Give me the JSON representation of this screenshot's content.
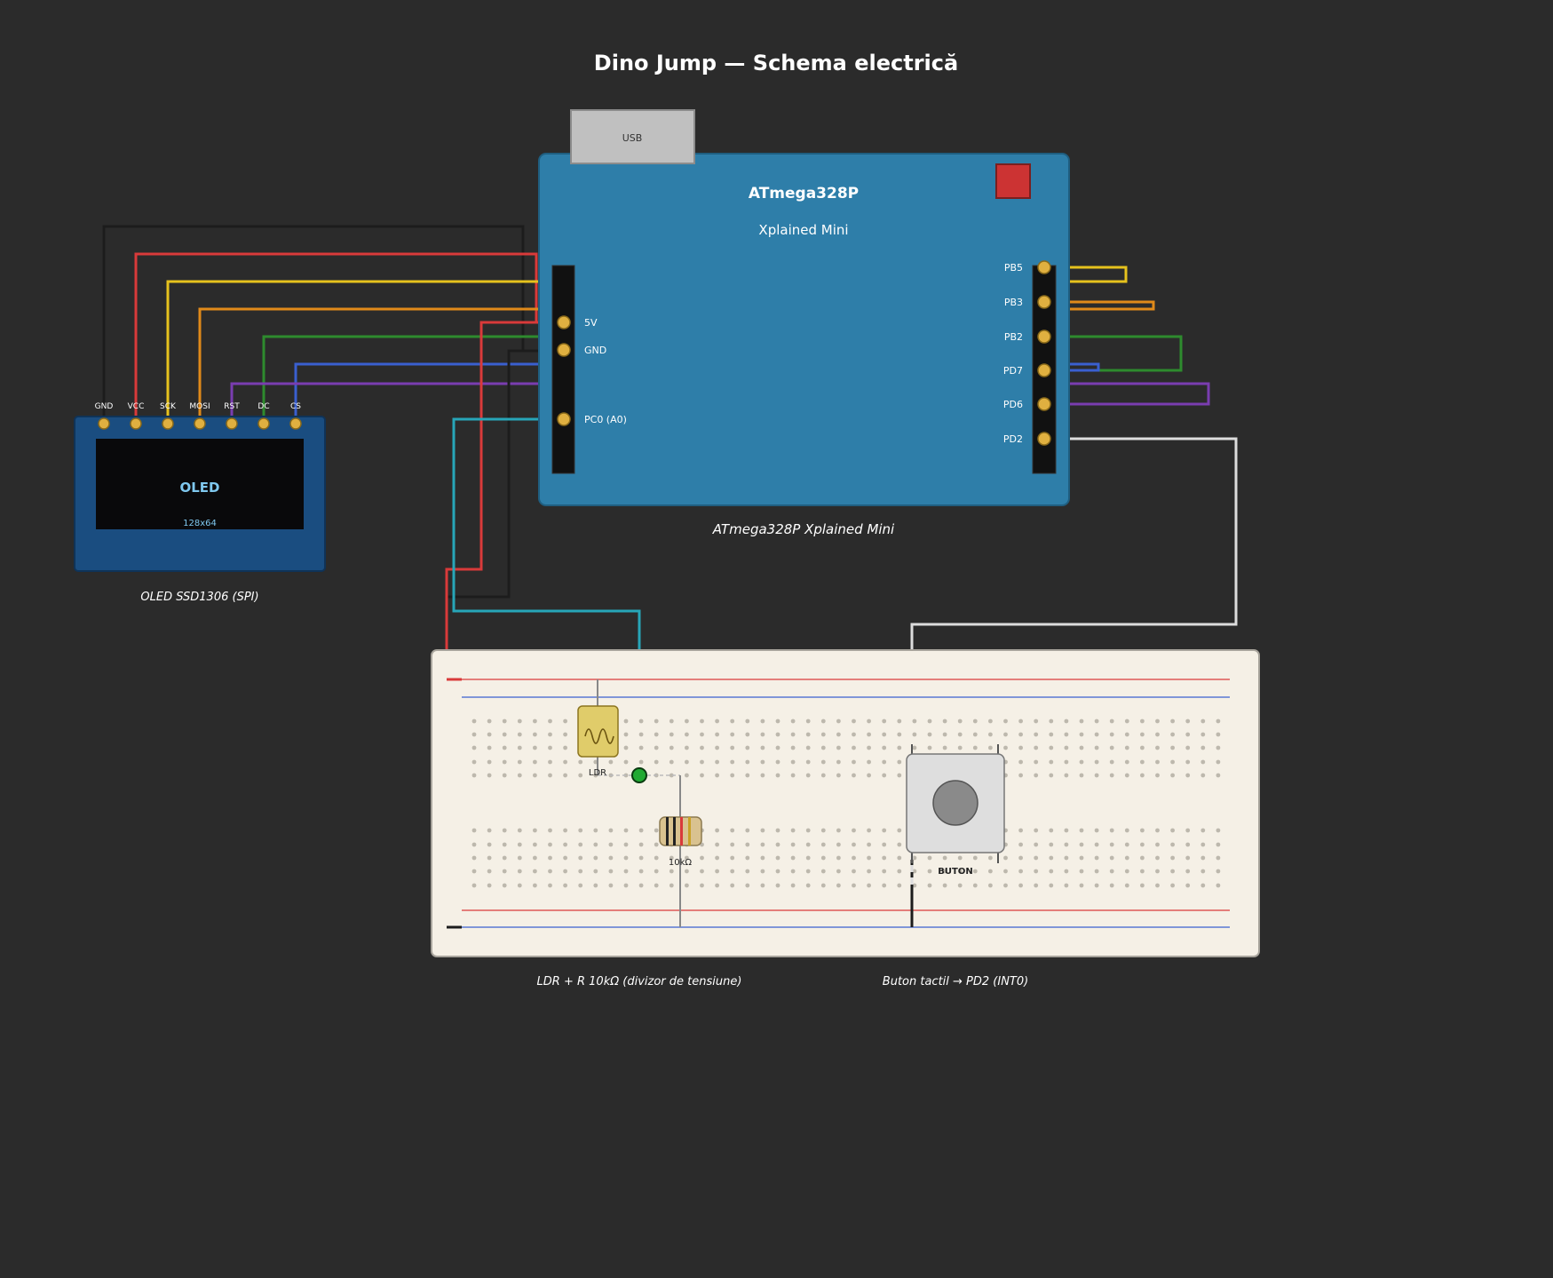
{
  "title": "Dino Jump — Schema electrică",
  "board": {
    "usb_label": "USB",
    "name": "ATmega328P",
    "subtitle": "Xplained Mini",
    "caption": "ATmega328P Xplained Mini",
    "left_pins": [
      "5V",
      "GND",
      "PC0 (A0)"
    ],
    "right_pins": [
      "PB5",
      "PB3",
      "PB2",
      "PD7",
      "PD6",
      "PD2"
    ]
  },
  "oled": {
    "pins": [
      "GND",
      "VCC",
      "SCK",
      "MOSI",
      "RST",
      "DC",
      "CS"
    ],
    "screen_label": "OLED",
    "resolution": "128x64",
    "caption": "OLED SSD1306 (SPI)"
  },
  "breadboard": {
    "ldr_label": "LDR",
    "resistor_label": "10kΩ",
    "button_label": "BUTON",
    "caption_divider": "LDR + R 10kΩ (divizor de tensiune)",
    "caption_button": "Buton tactil → PD2 (INT0)"
  },
  "colors": {
    "background": "#2b2b2b",
    "board": "#2e7ea9",
    "oled_pcb": "#1a4d80",
    "breadboard": "#f5f0e6",
    "pin_gold": "#e0b040",
    "wire_red": "#d93a3a",
    "wire_yellow": "#e6c21d",
    "wire_orange": "#e08a1a",
    "wire_green": "#2e8b2e",
    "wire_blue": "#3a5fcf",
    "wire_purple": "#7a3db0",
    "wire_cyan": "#27a6b8",
    "wire_white": "#dddddd",
    "wire_black": "#1c1c1c"
  }
}
